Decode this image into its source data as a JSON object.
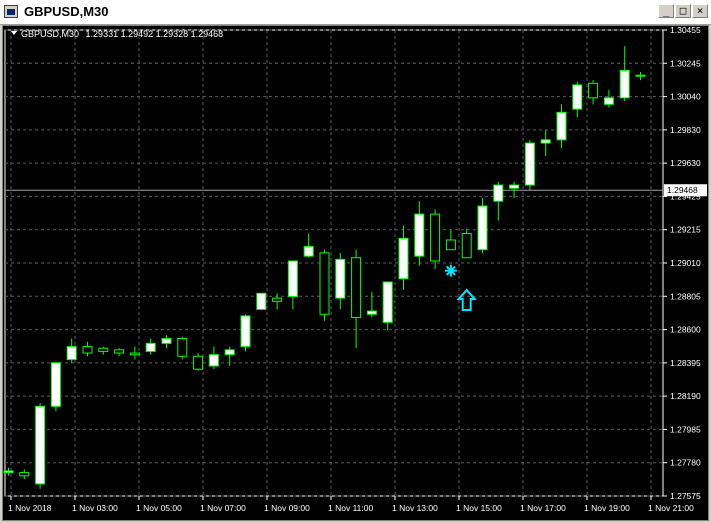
{
  "window": {
    "title": "GBPUSD,M30",
    "buttons": {
      "minimize": "_",
      "maximize": "□",
      "close": "×"
    }
  },
  "chart_header": {
    "symbol": "GBPUSD,M30",
    "ohlc": "1.29331 1.29492 1.29328 1.29468"
  },
  "colors": {
    "background": "#000000",
    "grid": "#5c5c5c",
    "bull_candle": "#ffffff",
    "candle_outline": "#00ff00",
    "bid_line": "#a0a0a0",
    "marker": "#00e5ff"
  },
  "chart_data": {
    "type": "candlestick",
    "title": "GBPUSD,M30",
    "ylim": [
      1.27575,
      1.3046
    ],
    "y_ticks": [
      "1.30455",
      "1.30245",
      "1.30040",
      "1.29830",
      "1.29630",
      "1.29425",
      "1.29215",
      "1.29010",
      "1.28805",
      "1.28600",
      "1.28395",
      "1.28190",
      "1.27985",
      "1.27780",
      "1.27575"
    ],
    "x_ticks": [
      "1 Nov 2018",
      "1 Nov 03:00",
      "1 Nov 05:00",
      "1 Nov 07:00",
      "1 Nov 09:00",
      "1 Nov 11:00",
      "1 Nov 13:00",
      "1 Nov 15:00",
      "1 Nov 17:00",
      "1 Nov 19:00",
      "1 Nov 21:00"
    ],
    "current_price": "1.29468",
    "candles": [
      [
        1.2772,
        1.2775,
        1.277,
        1.2773
      ],
      [
        1.2772,
        1.2774,
        1.2768,
        1.277
      ],
      [
        1.2765,
        1.2815,
        1.2762,
        1.2813
      ],
      [
        1.2813,
        1.284,
        1.281,
        1.284
      ],
      [
        1.2842,
        1.2855,
        1.284,
        1.285
      ],
      [
        1.285,
        1.2853,
        1.2844,
        1.2846
      ],
      [
        1.2849,
        1.285,
        1.2845,
        1.2847
      ],
      [
        1.2848,
        1.2849,
        1.2844,
        1.2846
      ],
      [
        1.2846,
        1.285,
        1.2842,
        1.2845
      ],
      [
        1.2847,
        1.2855,
        1.2845,
        1.2852
      ],
      [
        1.2852,
        1.2857,
        1.2849,
        1.2855
      ],
      [
        1.2855,
        1.2856,
        1.2842,
        1.2844
      ],
      [
        1.2844,
        1.2846,
        1.2835,
        1.2836
      ],
      [
        1.2838,
        1.285,
        1.2836,
        1.2845
      ],
      [
        1.2845,
        1.285,
        1.2838,
        1.2848
      ],
      [
        1.285,
        1.287,
        1.2847,
        1.2869
      ],
      [
        1.2873,
        1.2883,
        1.2873,
        1.2883
      ],
      [
        1.288,
        1.2883,
        1.2873,
        1.2878
      ],
      [
        1.2881,
        1.2903,
        1.2873,
        1.2903
      ],
      [
        1.2906,
        1.292,
        1.2905,
        1.2912
      ],
      [
        1.2908,
        1.291,
        1.2866,
        1.287
      ],
      [
        1.288,
        1.2908,
        1.2873,
        1.2904
      ],
      [
        1.2905,
        1.291,
        1.2849,
        1.2868
      ],
      [
        1.287,
        1.2884,
        1.2868,
        1.2872
      ],
      [
        1.2865,
        1.289,
        1.286,
        1.289
      ],
      [
        1.2892,
        1.2925,
        1.2885,
        1.2917
      ],
      [
        1.2906,
        1.294,
        1.29,
        1.2932
      ],
      [
        1.2932,
        1.2935,
        1.2898,
        1.2903
      ],
      [
        1.2916,
        1.2922,
        1.291,
        1.291
      ],
      [
        1.292,
        1.2923,
        1.2905,
        1.2905
      ],
      [
        1.291,
        1.2942,
        1.2908,
        1.2937
      ],
      [
        1.294,
        1.2952,
        1.2928,
        1.295
      ],
      [
        1.2948,
        1.2952,
        1.2942,
        1.295
      ],
      [
        1.295,
        1.2978,
        1.2947,
        1.2976
      ],
      [
        1.2976,
        1.2984,
        1.2968,
        1.2978
      ],
      [
        1.2978,
        1.3,
        1.2973,
        1.2995
      ],
      [
        1.2997,
        1.3014,
        1.2992,
        1.3012
      ],
      [
        1.3013,
        1.3015,
        1.3,
        1.3004
      ],
      [
        1.3,
        1.3009,
        1.2998,
        1.3004
      ],
      [
        1.3004,
        1.3036,
        1.3002,
        1.3021
      ],
      [
        1.3018,
        1.302,
        1.3015,
        1.3018
      ]
    ],
    "markers": [
      {
        "type": "star",
        "candle": 28,
        "price": 1.2897
      },
      {
        "type": "arrow-up",
        "candle": 29,
        "price": 1.2885
      }
    ]
  }
}
